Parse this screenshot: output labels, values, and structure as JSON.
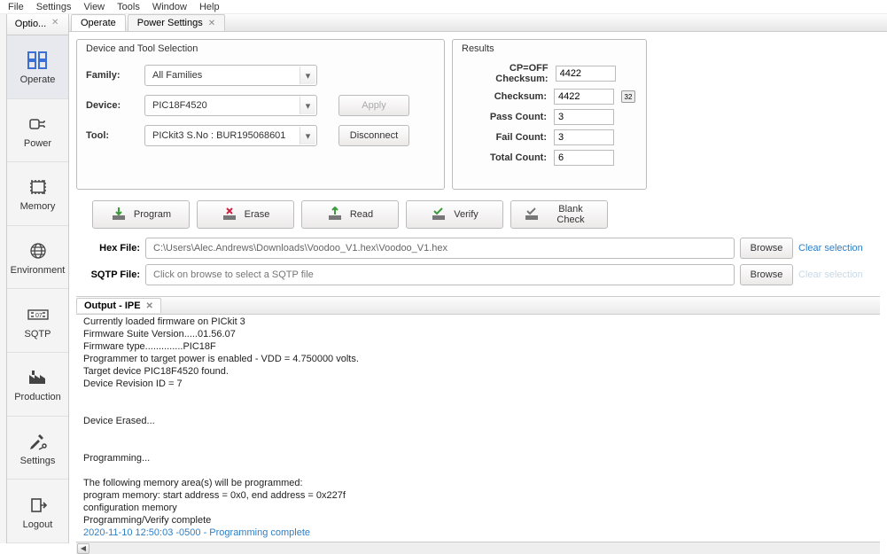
{
  "menu": [
    "File",
    "Settings",
    "View",
    "Tools",
    "Window",
    "Help"
  ],
  "sidebar": {
    "header": "Optio...",
    "items": [
      {
        "label": "Operate"
      },
      {
        "label": "Power"
      },
      {
        "label": "Memory"
      },
      {
        "label": "Environment"
      },
      {
        "label": "SQTP"
      },
      {
        "label": "Production"
      },
      {
        "label": "Settings"
      },
      {
        "label": "Logout"
      }
    ]
  },
  "tabs": [
    {
      "label": "Operate",
      "closable": false,
      "active": true
    },
    {
      "label": "Power Settings",
      "closable": true,
      "active": false
    }
  ],
  "device_panel": {
    "title": "Device and Tool Selection",
    "family_label": "Family:",
    "family_value": "All Families",
    "device_label": "Device:",
    "device_value": "PIC18F4520",
    "tool_label": "Tool:",
    "tool_value": "PICkit3 S.No : BUR195068601",
    "apply_label": "Apply",
    "disconnect_label": "Disconnect"
  },
  "results_panel": {
    "title": "Results",
    "cpoff_label": "CP=OFF Checksum:",
    "cpoff_value": "4422",
    "cksum_label": "Checksum:",
    "cksum_value": "4422",
    "pass_label": "Pass Count:",
    "pass_value": "3",
    "fail_label": "Fail Count:",
    "fail_value": "3",
    "total_label": "Total Count:",
    "total_value": "6",
    "hex_btn_label": "32"
  },
  "actions": {
    "program": "Program",
    "erase": "Erase",
    "read": "Read",
    "verify": "Verify",
    "blank": "Blank Check"
  },
  "files": {
    "hex_label": "Hex File:",
    "hex_value": "C:\\Users\\Alec.Andrews\\Downloads\\Voodoo_V1.hex\\Voodoo_V1.hex",
    "sqtp_label": "SQTP File:",
    "sqtp_placeholder": "Click on browse to select a SQTP file",
    "browse_label": "Browse",
    "clear_label": "Clear selection"
  },
  "output": {
    "tab_label": "Output - IPE",
    "lines_plain": "Currently loaded firmware on PICkit 3\nFirmware Suite Version.....01.56.07\nFirmware type..............PIC18F\nProgrammer to target power is enabled - VDD = 4.750000 volts.\nTarget device PIC18F4520 found.\nDevice Revision ID = 7\n\n\nDevice Erased...\n\n\nProgramming...\n\nThe following memory area(s) will be programmed:\nprogram memory: start address = 0x0, end address = 0x227f\nconfiguration memory\nProgramming/Verify complete",
    "line_hl": "2020-11-10 12:50:03 -0500 - Programming complete"
  }
}
